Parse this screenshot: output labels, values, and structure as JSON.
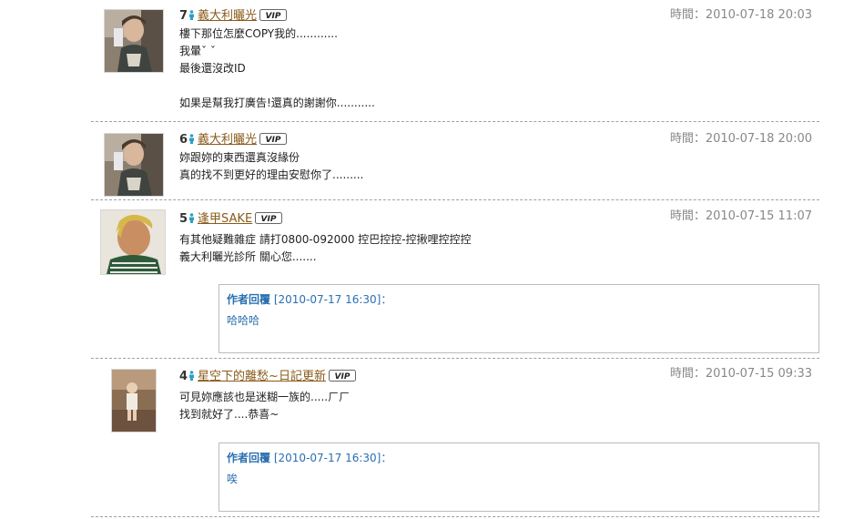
{
  "comments": [
    {
      "number": "7",
      "username": "義大利曬光",
      "time": "時間：2010-07-18 20:03",
      "lines": [
        "樓下那位怎麼COPY我的............",
        "我暈ˇ ˇ",
        "最後還沒改ID",
        "",
        "如果是幫我打廣告!還真的謝謝你..........."
      ],
      "avatar_icon": "avatar-photo-young-man"
    },
    {
      "number": "6",
      "username": "義大利曬光",
      "time": "時間：2010-07-18 20:00",
      "lines": [
        "妳跟妳的東西還真沒緣份",
        "真的找不到更好的理由安慰你了........."
      ],
      "avatar_icon": "avatar-photo-young-man"
    },
    {
      "number": "5",
      "username": "逢甲SAKE",
      "time": "時間：2010-07-15 11:07",
      "lines": [
        "有其他疑難雜症 請打0800-092000 控巴控控-控揪哩控控控",
        "義大利曬光診所 關心您......."
      ],
      "avatar_icon": "avatar-photo-blond-man",
      "reply": {
        "label": "作者回覆",
        "date": "[2010-07-17 16:30]",
        "colon": "：",
        "text": "哈哈哈"
      }
    },
    {
      "number": "4",
      "username": "星空下的離愁~日記更新",
      "time": "時間：2010-07-15 09:33",
      "lines": [
        "可見妳應該也是迷糊一族的.....ㄏㄏ",
        "找到就好了....恭喜~"
      ],
      "avatar_icon": "avatar-photo-child",
      "reply": {
        "label": "作者回覆",
        "date": "[2010-07-17 16:30]",
        "colon": "：",
        "text": "唉"
      }
    }
  ],
  "badge_text": "VIP",
  "colors": {
    "username": "#8a5a1a",
    "reply": "#2a6fb0",
    "time": "#888888",
    "person_icon": "#2aa0c8"
  }
}
